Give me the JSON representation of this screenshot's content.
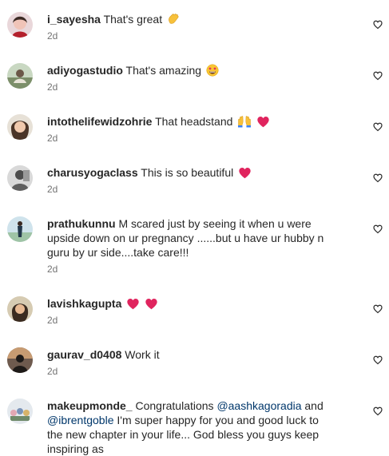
{
  "comments": [
    {
      "username": "i_sayesha",
      "text": "That's great",
      "emojis": [
        "clapping-hands"
      ],
      "time": "2d"
    },
    {
      "username": "adiyogastudio",
      "text": "That's amazing",
      "emojis": [
        "star-struck"
      ],
      "time": "2d"
    },
    {
      "username": "intothelifewidzohrie",
      "text": "That headstand",
      "emojis": [
        "raising-hands",
        "red-heart"
      ],
      "time": "2d"
    },
    {
      "username": "charusyogaclass",
      "text": "This is so beautiful",
      "emojis": [
        "red-heart"
      ],
      "time": "2d"
    },
    {
      "username": "prathukunnu",
      "text": "M scared just by seeing it when u were upside down on ur pregnancy ......but u have ur hubby n guru by ur side....take care!!!",
      "emojis": [],
      "time": "2d"
    },
    {
      "username": "lavishkagupta",
      "text": "",
      "emojis": [
        "red-heart",
        "red-heart"
      ],
      "time": "2d"
    },
    {
      "username": "gaurav_d0408",
      "text": "Work it",
      "emojis": [],
      "time": "2d"
    },
    {
      "username": "makeupmonde_",
      "text_parts": [
        {
          "type": "text",
          "value": "Congratulations "
        },
        {
          "type": "mention",
          "value": "@aashkagoradia"
        },
        {
          "type": "text",
          "value": " and "
        },
        {
          "type": "mention",
          "value": "@ibrentgoble"
        },
        {
          "type": "text",
          "value": " I'm super happy for you and good luck to the new chapter in your life... God bless you guys keep inspiring as"
        }
      ],
      "emojis": [],
      "time": ""
    }
  ],
  "icons": {
    "like": "heart-outline-icon"
  },
  "colors": {
    "text": "#262626",
    "secondary": "#737373",
    "mention": "#00376b",
    "heart_red": "#e0245e"
  }
}
